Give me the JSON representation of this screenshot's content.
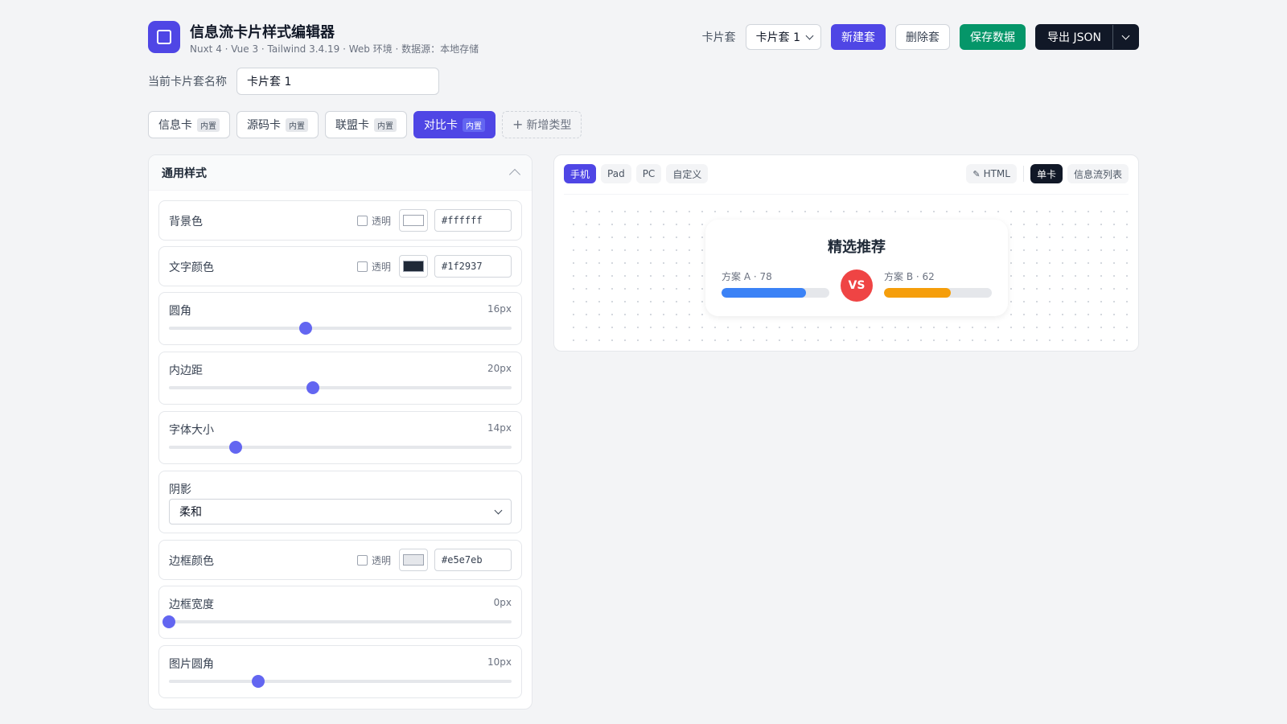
{
  "header": {
    "title": "信息流卡片样式编辑器",
    "subtitle": "Nuxt 4 · Vue 3 · Tailwind 3.4.19 · Web 环境 · 数据源：本地存储",
    "set_label": "卡片套",
    "set_select_value": "卡片套 1",
    "new_set": "新建套",
    "delete_set": "删除套",
    "save_data": "保存数据",
    "export_json": "导出 JSON"
  },
  "name_row": {
    "label": "当前卡片套名称",
    "value": "卡片套 1"
  },
  "card_types": [
    {
      "label": "信息卡",
      "badge": "内置",
      "active": false
    },
    {
      "label": "源码卡",
      "badge": "内置",
      "active": false
    },
    {
      "label": "联盟卡",
      "badge": "内置",
      "active": false
    },
    {
      "label": "对比卡",
      "badge": "内置",
      "active": true
    }
  ],
  "add_type": "新增类型",
  "panel": {
    "title": "通用样式",
    "transparent_label": "透明",
    "bg_color": {
      "label": "背景色",
      "value": "#ffffff"
    },
    "text_color": {
      "label": "文字颜色",
      "value": "#1f2937"
    },
    "radius": {
      "label": "圆角",
      "value": "16px",
      "fraction": 0.4
    },
    "padding": {
      "label": "内边距",
      "value": "20px",
      "fraction": 0.42
    },
    "font_size": {
      "label": "字体大小",
      "value": "14px",
      "fraction": 0.195
    },
    "shadow": {
      "label": "阴影",
      "value": "柔和"
    },
    "border_color": {
      "label": "边框颜色",
      "value": "#e5e7eb"
    },
    "border_width": {
      "label": "边框宽度",
      "value": "0px",
      "fraction": 0.0
    },
    "image_radius": {
      "label": "图片圆角",
      "value": "10px",
      "fraction": 0.26
    }
  },
  "preview": {
    "devices": [
      "手机",
      "Pad",
      "PC",
      "自定义"
    ],
    "active_device": "手机",
    "html_btn": "HTML",
    "modes": [
      "单卡",
      "信息流列表"
    ],
    "active_mode": "单卡",
    "card": {
      "title": "精选推荐",
      "left_label": "方案 A · 78",
      "left_value": 78,
      "right_label": "方案 B · 62",
      "right_value": 62,
      "vs": "VS",
      "left_color": "#3b82f6",
      "right_color": "#f59e0b",
      "vs_color": "#ef4444"
    }
  },
  "colors": {
    "accent": "#4f46e5",
    "save": "#059669",
    "dark": "#111827"
  }
}
